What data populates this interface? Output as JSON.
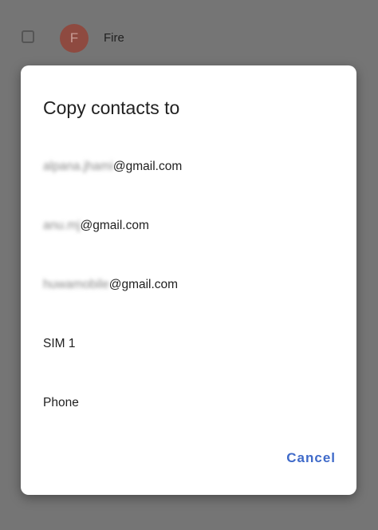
{
  "background": {
    "contact_initial": "F",
    "contact_name": "Fire"
  },
  "dialog": {
    "title": "Copy contacts to",
    "options": [
      {
        "blurred_part": "alpana.jhami",
        "visible_part": "@gmail.com"
      },
      {
        "blurred_part": "anu.mj",
        "visible_part": "@gmail.com"
      },
      {
        "blurred_part": "huwamobile",
        "visible_part": "@gmail.com"
      },
      {
        "blurred_part": "",
        "visible_part": "SIM 1"
      },
      {
        "blurred_part": "",
        "visible_part": "Phone"
      }
    ],
    "cancel_label": "Cancel"
  },
  "colors": {
    "scrim": "#757575",
    "accent": "#3f6ac9",
    "avatar": "#8e4a40"
  }
}
